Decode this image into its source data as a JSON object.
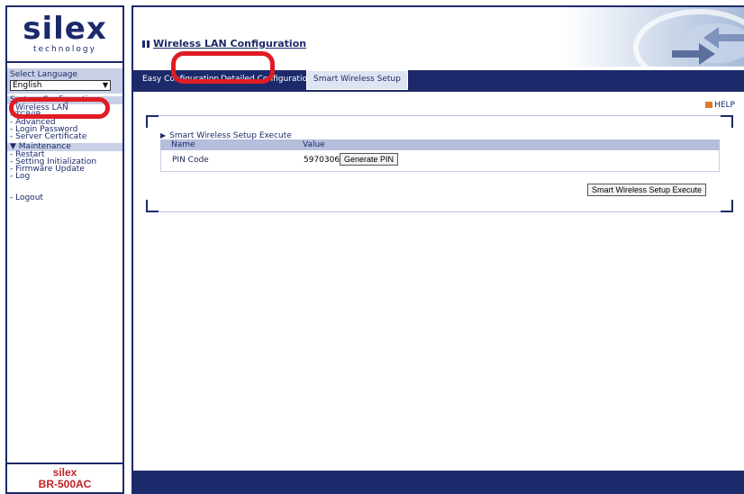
{
  "sidebar": {
    "logo_main": "silex",
    "logo_sub": "technology",
    "language_label": "Select Language",
    "language_value": "English",
    "config_header": "System Configuration",
    "config_items": [
      "- Wireless LAN",
      "- TCP/IP",
      "- Advanced",
      "- Login Password",
      "- Server Certificate"
    ],
    "maintenance_header": "▼ Maintenance",
    "maintenance_items": [
      "- Restart",
      "- Setting Initialization",
      "- Firmware Update",
      "- Log"
    ],
    "logout": "- Logout",
    "brand": "silex",
    "model": "BR-500AC"
  },
  "header": {
    "title": "Wireless LAN Configuration"
  },
  "tabs": [
    "Easy Configuration",
    "Detailed Configuratio",
    "Smart Wireless Setup"
  ],
  "help": "HELP",
  "section": {
    "title": "Smart Wireless Setup Execute",
    "columns": [
      "Name",
      "Value"
    ],
    "pin_label": "PIN Code",
    "pin_value": "59703068",
    "generate_button": "Generate PIN",
    "execute_button": "Smart Wireless Setup Execute"
  },
  "colors": {
    "navy": "#1c2a6b",
    "highlight": "#e01b24",
    "accent_red": "#c31f24"
  },
  "icons": [
    "dropdown-arrow-icon",
    "triangle-bullet-icon",
    "help-icon",
    "title-mark-icon"
  ]
}
